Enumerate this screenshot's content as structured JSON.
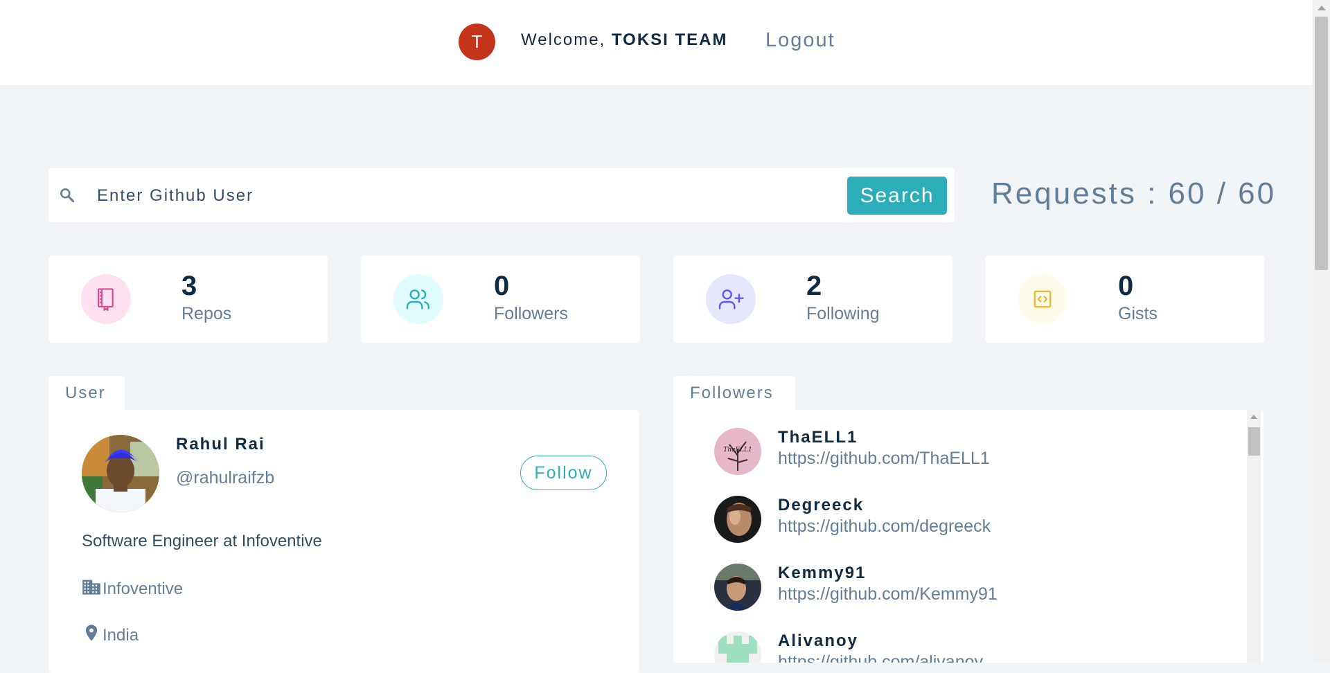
{
  "navbar": {
    "avatar_initial": "T",
    "welcome_text": "Welcome,",
    "user_name": "TOKSI TEAM",
    "logout_label": "Logout"
  },
  "search": {
    "placeholder": "Enter Github User",
    "button_label": "Search",
    "requests_text": "Requests : 60 / 60"
  },
  "stats": [
    {
      "value": "3",
      "label": "Repos",
      "icon": "book-icon",
      "color": "#da4a91",
      "bg": "#ffe0f0"
    },
    {
      "value": "0",
      "label": "Followers",
      "icon": "users-icon",
      "color": "#2caeba",
      "bg": "#e0fcff"
    },
    {
      "value": "2",
      "label": "Following",
      "icon": "user-plus-icon",
      "color": "#5d55fa",
      "bg": "#e6e6ff"
    },
    {
      "value": "0",
      "label": "Gists",
      "icon": "code-icon",
      "color": "#f0b429",
      "bg": "#fffbea"
    }
  ],
  "user_panel": {
    "tab_label": "User",
    "name": "Rahul Rai",
    "handle": "@rahulraifzb",
    "follow_label": "Follow",
    "bio": "Software Engineer at Infoventive",
    "company": "Infoventive",
    "location": "India"
  },
  "followers_panel": {
    "tab_label": "Followers",
    "items": [
      {
        "name": "ThaELL1",
        "url": "https://github.com/ThaELL1",
        "avatar_text": "ThaELL1"
      },
      {
        "name": "Degreeck",
        "url": "https://github.com/degreeck"
      },
      {
        "name": "Kemmy91",
        "url": "https://github.com/Kemmy91"
      },
      {
        "name": "Alivanoy",
        "url": "https://github.com/alivanoy"
      }
    ]
  }
}
